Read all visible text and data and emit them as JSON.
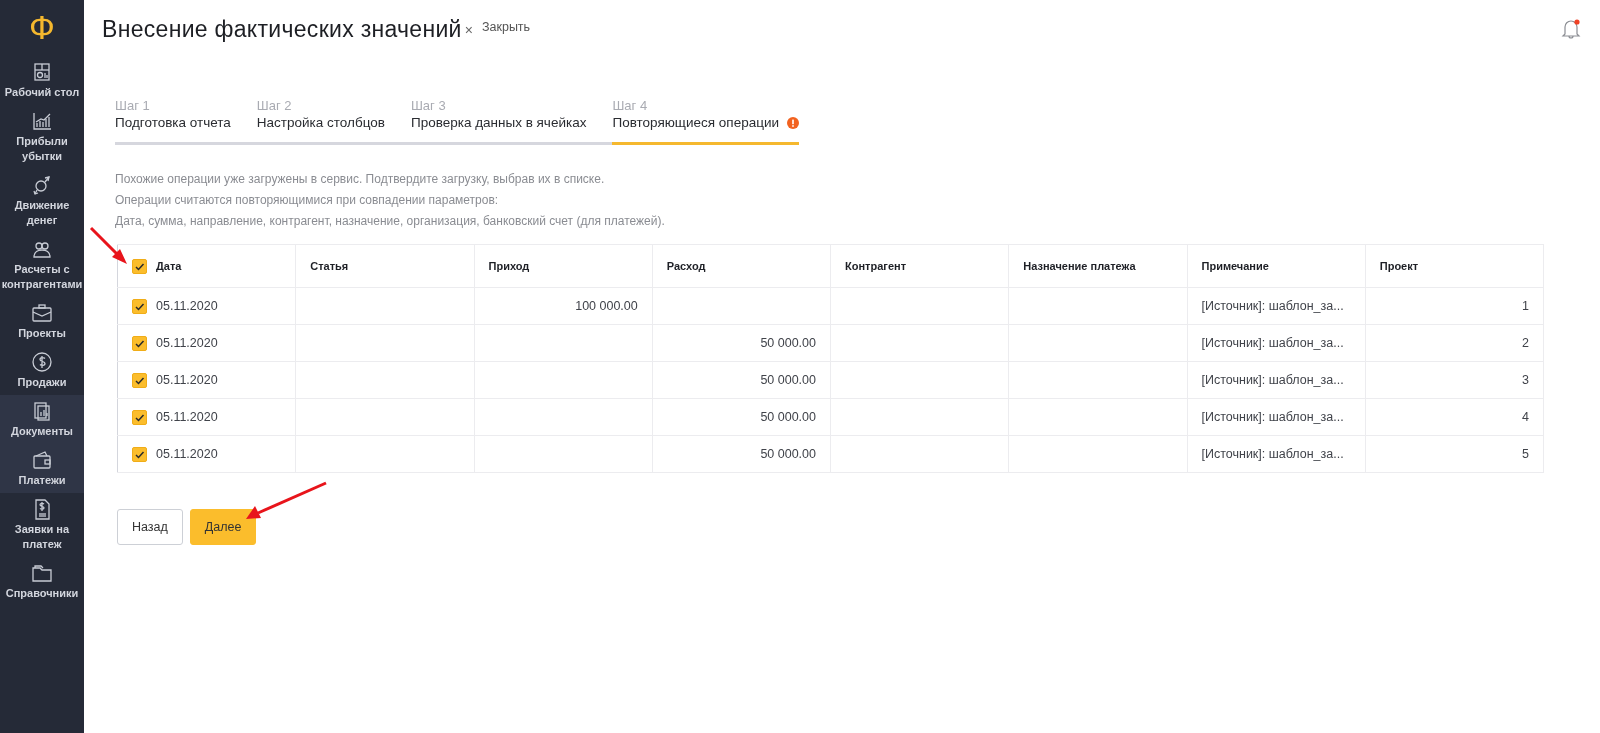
{
  "sidebar": {
    "logo": "Ф",
    "items": [
      {
        "label": "Рабочий стол",
        "selected": false
      },
      {
        "label": "Прибыли убытки",
        "selected": false
      },
      {
        "label": "Движение денег",
        "selected": false
      },
      {
        "label": "Расчеты с контрагентами",
        "selected": false
      },
      {
        "label": "Проекты",
        "selected": false
      },
      {
        "label": "Продажи",
        "selected": false
      },
      {
        "label": "Документы",
        "selected": true
      },
      {
        "label": "Платежи",
        "selected": true
      },
      {
        "label": "Заявки на платеж",
        "selected": false
      },
      {
        "label": "Справочники",
        "selected": false
      }
    ]
  },
  "header": {
    "title": "Внесение фактических значений",
    "close_icon": "×",
    "close_label": "Закрыть",
    "notification_unread": true
  },
  "steps": [
    {
      "number": "Шаг 1",
      "title": "Подготовка отчета",
      "selected": false,
      "warning": false
    },
    {
      "number": "Шаг 2",
      "title": "Настройка столбцов",
      "selected": false,
      "warning": false
    },
    {
      "number": "Шаг 3",
      "title": "Проверка данных в ячейках",
      "selected": false,
      "warning": false
    },
    {
      "number": "Шаг 4",
      "title": "Повторяющиеся операции",
      "selected": true,
      "warning": true
    }
  ],
  "notes": [
    "Похожие операции уже загружены в сервис. Подтвердите загрузку, выбрав их в списке.",
    "Операции считаются повторяющимися при совпадении параметров:",
    "Дата, сумма, направление, контрагент, назначение, организация, банковский счет (для платежей)."
  ],
  "table": {
    "all_checked": true,
    "columns": [
      {
        "label": "Дата",
        "kind": "text"
      },
      {
        "label": "Статья",
        "kind": "text"
      },
      {
        "label": "Приход",
        "kind": "number"
      },
      {
        "label": "Расход",
        "kind": "number"
      },
      {
        "label": "Контрагент",
        "kind": "text"
      },
      {
        "label": "Назначение платежа",
        "kind": "text"
      },
      {
        "label": "Примечание",
        "kind": "text"
      },
      {
        "label": "Проект",
        "kind": "number"
      }
    ],
    "rows": [
      {
        "checked": true,
        "cells": [
          "05.11.2020",
          "",
          "100 000.00",
          "",
          "",
          "",
          "[Источник]: шаблон_за...",
          "1"
        ]
      },
      {
        "checked": true,
        "cells": [
          "05.11.2020",
          "",
          "",
          "50 000.00",
          "",
          "",
          "[Источник]: шаблон_за...",
          "2"
        ]
      },
      {
        "checked": true,
        "cells": [
          "05.11.2020",
          "",
          "",
          "50 000.00",
          "",
          "",
          "[Источник]: шаблон_за...",
          "3"
        ]
      },
      {
        "checked": true,
        "cells": [
          "05.11.2020",
          "",
          "",
          "50 000.00",
          "",
          "",
          "[Источник]: шаблон_за...",
          "4"
        ]
      },
      {
        "checked": true,
        "cells": [
          "05.11.2020",
          "",
          "",
          "50 000.00",
          "",
          "",
          "[Источник]: шаблон_за...",
          "5"
        ]
      }
    ]
  },
  "buttons": [
    {
      "label": "Назад",
      "kind": "secondary"
    },
    {
      "label": "Далее",
      "kind": "primary"
    }
  ]
}
